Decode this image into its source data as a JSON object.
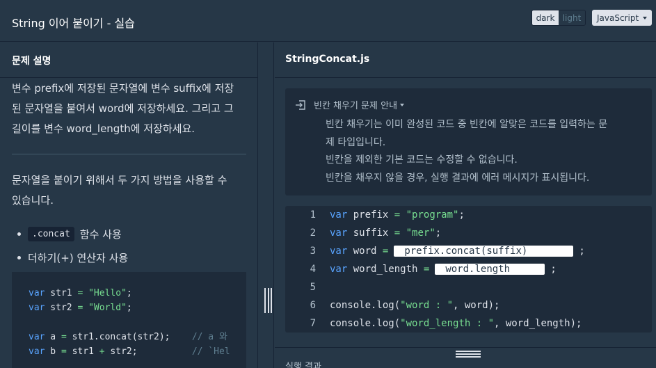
{
  "header": {
    "title": "String 이어 붙이기 - 실습",
    "theme": {
      "dark_label": "dark",
      "light_label": "light",
      "selected": "dark"
    },
    "language": "JavaScript"
  },
  "left": {
    "section_title": "문제 설명",
    "description_lines": [
      "변수 prefix에 저장된 문자열에 변수 suffix에 저장",
      "된 문자열을 붙여서 word에 저장하세요. 그리고 그",
      "길이를 변수 word_length에 저장하세요."
    ],
    "description2_lines": [
      "문자열을 붙이기 위해서 두 가지 방법을 사용할 수",
      "있습니다."
    ],
    "bullets": [
      {
        "code": ".concat",
        "text": "함수 사용"
      },
      {
        "code": "",
        "text": "더하기(+) 연산자 사용"
      }
    ],
    "example": {
      "l1_kw": "var",
      "l1_rest": " str1 ",
      "l1_op": "=",
      "l1_str": " \"Hello\"",
      "l1_end": ";",
      "l2_kw": "var",
      "l2_rest": " str2 ",
      "l2_op": "=",
      "l2_str": " \"World\"",
      "l2_end": ";",
      "l4_kw": "var",
      "l4_rest": " a ",
      "l4_op": "=",
      "l4_code": " str1.concat(str2);    ",
      "l4_cmt": "// a 와",
      "l5_kw": "var",
      "l5_rest": " b ",
      "l5_op": "=",
      "l5_code": " str1 ",
      "l5_plus": "+",
      "l5_code2": " str2;          ",
      "l5_cmt": "// `Hel"
    }
  },
  "right": {
    "file_name": "StringConcat.js",
    "guide": {
      "header": "빈칸 채우기 문제 안내",
      "lines": [
        "빈칸 채우기는 이미 완성된 코드 중 빈칸에 알맞은 코드를 입력하는 문",
        "제 타입입니다.",
        "빈칸을 제외한 기본 코드는 수정할 수 없습니다.",
        "빈칸을 채우지 않을 경우, 실행 결과에 에러 메시지가 표시됩니다."
      ]
    },
    "code_lines": [
      {
        "n": "1",
        "kw": "var",
        "name": " prefix ",
        "op": "=",
        "str": " \"program\"",
        "end": ";"
      },
      {
        "n": "2",
        "kw": "var",
        "name": " suffix ",
        "op": "=",
        "str": " \"mer\"",
        "end": ";"
      },
      {
        "n": "3",
        "kw": "var",
        "name": " word ",
        "op": "=",
        "blank": "prefix.concat(suffix)",
        "end": ";"
      },
      {
        "n": "4",
        "kw": "var",
        "name": " word_length ",
        "op": "=",
        "blank": "word.length",
        "end": ";"
      },
      {
        "n": "5"
      },
      {
        "n": "6",
        "pre": "console.log(",
        "str": "\"word : \"",
        "post": ", word);"
      },
      {
        "n": "7",
        "pre": "console.log(",
        "str": "\"word_length : \"",
        "post": ", word_length);"
      }
    ],
    "result_label": "실행 결과"
  }
}
